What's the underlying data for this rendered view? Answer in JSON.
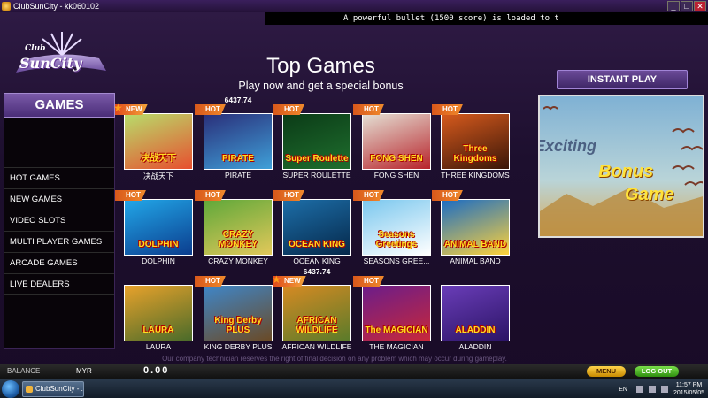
{
  "window": {
    "title": "ClubSunCity - kk060102",
    "buttons": [
      "_",
      "□",
      "✕"
    ]
  },
  "ticker": "A powerful bullet (1500 score) is loaded to t",
  "logo": {
    "line1": "Club",
    "line2": "SunCity"
  },
  "sidebar": {
    "header": "GAMES",
    "items": [
      {
        "label": "HOT GAMES"
      },
      {
        "label": "NEW GAMES"
      },
      {
        "label": "VIDEO SLOTS"
      },
      {
        "label": "MULTI PLAYER GAMES"
      },
      {
        "label": "ARCADE GAMES"
      },
      {
        "label": "LIVE DEALERS"
      }
    ]
  },
  "main": {
    "title": "Top Games",
    "subtitle": "Play now and get a special bonus",
    "games": [
      {
        "name": "决战天下",
        "badge": "NEW",
        "jackpot": "",
        "colors": [
          "#b8dd6b",
          "#e74f2f"
        ],
        "thumb_text": "决战天下"
      },
      {
        "name": "PIRATE",
        "badge": "HOT",
        "jackpot": "6437.74",
        "colors": [
          "#2a2f7a",
          "#3fa0d8"
        ],
        "thumb_text": "PIRATE"
      },
      {
        "name": "SUPER ROULETTE",
        "badge": "HOT",
        "jackpot": "",
        "colors": [
          "#0b3b17",
          "#1f6f2e"
        ],
        "thumb_text": "Super Roulette"
      },
      {
        "name": "FONG SHEN",
        "badge": "HOT",
        "jackpot": "",
        "colors": [
          "#e4e0d4",
          "#b8232b"
        ],
        "thumb_text": "FONG SHEN"
      },
      {
        "name": "THREE KINGDOMS",
        "badge": "HOT",
        "jackpot": "",
        "colors": [
          "#d65a1d",
          "#3a1608"
        ],
        "thumb_text": "Three Kingdoms"
      },
      {
        "name": "DOLPHIN",
        "badge": "HOT",
        "jackpot": "",
        "colors": [
          "#22a7e8",
          "#0b3d8e"
        ],
        "thumb_text": "DOLPHIN"
      },
      {
        "name": "CRAZY MONKEY",
        "badge": "HOT",
        "jackpot": "",
        "colors": [
          "#5fa83a",
          "#e2c85a"
        ],
        "thumb_text": "CRAZY MONKEY"
      },
      {
        "name": "OCEAN KING",
        "badge": "HOT",
        "jackpot": "",
        "colors": [
          "#1d6ea8",
          "#05284a"
        ],
        "thumb_text": "OCEAN KING"
      },
      {
        "name": "SEASONS GREE...",
        "badge": "HOT",
        "jackpot": "",
        "colors": [
          "#7ac7ee",
          "#ffffff"
        ],
        "thumb_text": "Seasons Greetings"
      },
      {
        "name": "ANIMAL BAND",
        "badge": "HOT",
        "jackpot": "",
        "colors": [
          "#1b6cc4",
          "#ffd33a"
        ],
        "thumb_text": "ANIMAL BAND"
      },
      {
        "name": "LAURA",
        "badge": "",
        "jackpot": "",
        "colors": [
          "#e8a22b",
          "#4a6b2a"
        ],
        "thumb_text": "LAURA"
      },
      {
        "name": "KING DERBY PLUS",
        "badge": "HOT",
        "jackpot": "",
        "colors": [
          "#3f86c8",
          "#6a4a26"
        ],
        "thumb_text": "King Derby PLUS"
      },
      {
        "name": "AFRICAN WILDLIFE",
        "badge": "NEW",
        "jackpot": "6437.74",
        "colors": [
          "#d68a23",
          "#5a7b2a"
        ],
        "thumb_text": "AFRICAN WILDLIFE"
      },
      {
        "name": "THE MAGICIAN",
        "badge": "HOT",
        "jackpot": "",
        "colors": [
          "#6b1d8a",
          "#c8283a"
        ],
        "thumb_text": "The MAGICIAN"
      },
      {
        "name": "ALADDIN",
        "badge": "",
        "jackpot": "",
        "colors": [
          "#6a3db8",
          "#2b1466"
        ],
        "thumb_text": "ALADDIN"
      }
    ]
  },
  "promo": {
    "button": "INSTANT PLAY",
    "line1": "Exciting",
    "line2": "Bonus",
    "line3": "Game"
  },
  "footer": {
    "disclaimer": "Our company technician reserves the right of final decision on any problem which may occur during gameplay.",
    "balance_label": "BALANCE",
    "currency": "MYR",
    "balance": "0.00",
    "menu_button": "MENU",
    "logout_button": "LOG OUT"
  },
  "taskbar": {
    "app": "ClubSunCity - ...",
    "lang": "EN",
    "time": "11:57 PM",
    "date": "2015/05/05"
  }
}
